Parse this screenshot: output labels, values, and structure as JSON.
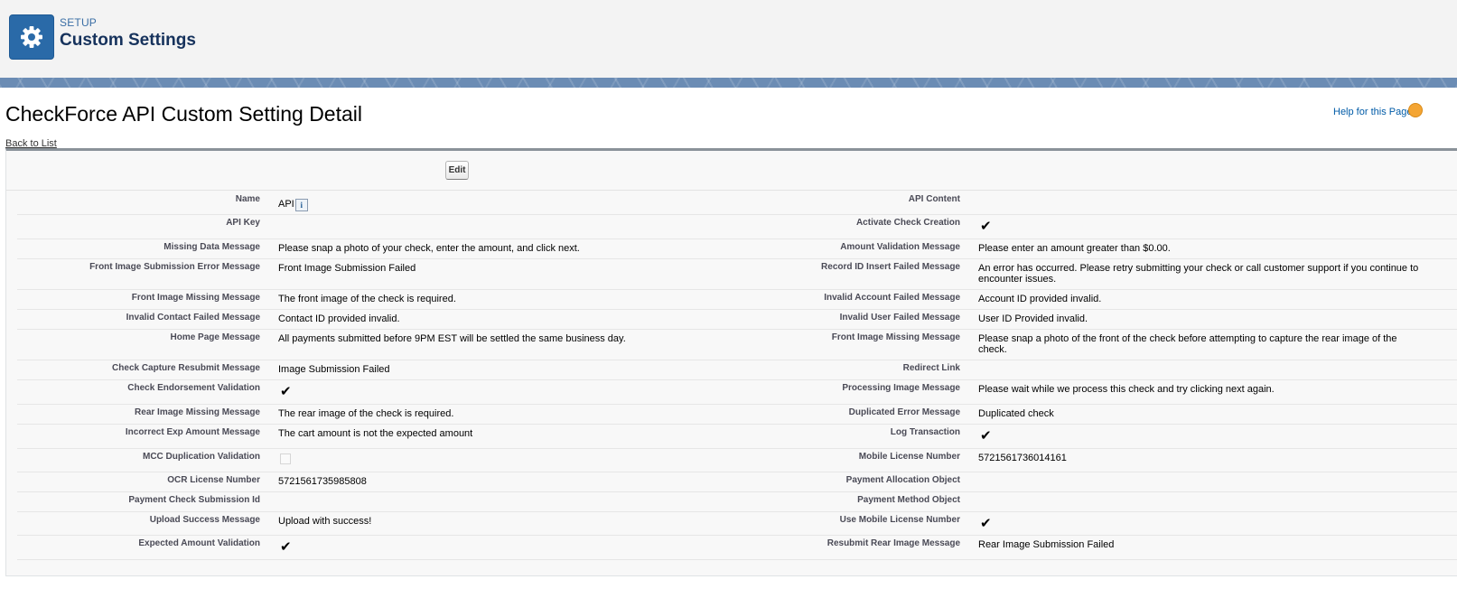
{
  "header": {
    "eyebrow": "SETUP",
    "title": "Custom Settings",
    "icon": "gear-icon"
  },
  "page": {
    "title": "CheckForce API Custom Setting Detail",
    "help_link": "Help for this Page",
    "back_link": "Back to List",
    "edit_label": "Edit"
  },
  "colors": {
    "header_icon_bg": "#2a6aa8",
    "link": "#015ba7",
    "label": "#4a4a56"
  },
  "rows": [
    {
      "l1": "Name",
      "v1": "API",
      "v1_info": true,
      "l2": "API Content",
      "v2": ""
    },
    {
      "l1": "API Key",
      "v1": "",
      "l2": "Activate Check Creation",
      "v2": "",
      "v2_check": "checked"
    },
    {
      "l1": "Missing Data Message",
      "v1": "Please snap a photo of your check, enter the amount, and click next.",
      "l2": "Amount Validation Message",
      "v2": "Please enter an amount greater than $0.00."
    },
    {
      "l1": "Front Image Submission Error Message",
      "v1": "Front Image Submission Failed",
      "l2": "Record ID Insert Failed Message",
      "v2": "An error has occurred. Please retry submitting your check or call customer support if you continue to encounter issues."
    },
    {
      "l1": "Front Image Missing Message",
      "v1": "The front image of the check is required.",
      "l2": "Invalid Account Failed Message",
      "v2": "Account ID provided invalid."
    },
    {
      "l1": "Invalid Contact Failed Message",
      "v1": "Contact ID provided invalid.",
      "l2": "Invalid User Failed Message",
      "v2": "User ID Provided invalid."
    },
    {
      "l1": "Home Page Message",
      "v1": "All payments submitted before 9PM EST will be settled the same business day.",
      "l2": "Front Image Missing Message",
      "v2": "Please snap a photo of the front of the check before attempting to capture the rear image of the check."
    },
    {
      "l1": "Check Capture Resubmit Message",
      "v1": "Image Submission Failed",
      "l2": "Redirect Link",
      "v2": ""
    },
    {
      "l1": "Check Endorsement Validation",
      "v1": "",
      "v1_check": "checked",
      "l2": "Processing Image Message",
      "v2": "Please wait while we process this check and try clicking next again."
    },
    {
      "l1": "Rear Image Missing Message",
      "v1": "The rear image of the check is required.",
      "l2": "Duplicated Error Message",
      "v2": "Duplicated check"
    },
    {
      "l1": "Incorrect Exp Amount Message",
      "v1": "The cart amount is not the expected amount",
      "l2": "Log Transaction",
      "v2": "",
      "v2_check": "checked"
    },
    {
      "l1": "MCC Duplication Validation",
      "v1": "",
      "v1_check": "unchecked",
      "l2": "Mobile License Number",
      "v2": "5721561736014161"
    },
    {
      "l1": "OCR License Number",
      "v1": "5721561735985808",
      "l2": "Payment Allocation Object",
      "v2": ""
    },
    {
      "l1": "Payment Check Submission Id",
      "v1": "",
      "l2": "Payment Method Object",
      "v2": ""
    },
    {
      "l1": "Upload Success Message",
      "v1": "Upload with success!",
      "l2": "Use Mobile License Number",
      "v2": "",
      "v2_check": "checked"
    },
    {
      "l1": "Expected Amount Validation",
      "v1": "",
      "v1_check": "checked",
      "l2": "Resubmit Rear Image Message",
      "v2": "Rear Image Submission Failed"
    }
  ]
}
